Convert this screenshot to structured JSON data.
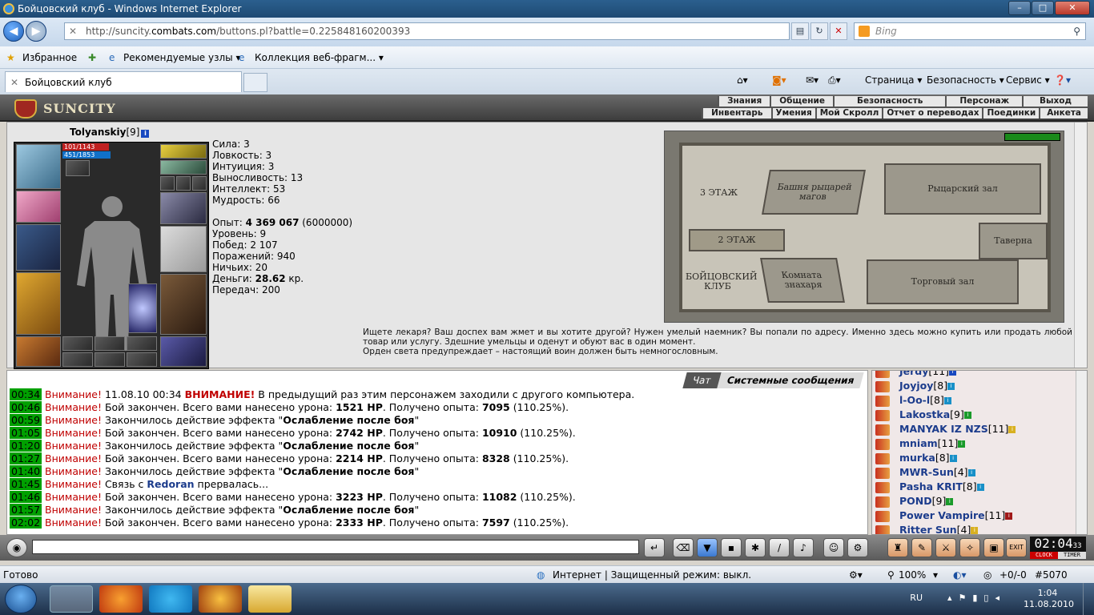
{
  "window": {
    "title": "Бойцовский клуб - Windows Internet Explorer",
    "controls": [
      "–",
      "□",
      "✕"
    ]
  },
  "address": {
    "url_prefix": "http://suncity.",
    "url_domain": "combats.com",
    "url_path": "/buttons.pl?battle=0.225848160200393",
    "search_placeholder": "Bing"
  },
  "favorites": {
    "label": "Избранное",
    "links": [
      "Рекомендуемые узлы ▾",
      "Коллекция веб-фрагм... ▾"
    ]
  },
  "tabs": {
    "active": "Бойцовский клуб",
    "commands": [
      "Страница ▾",
      "Безопасность ▾",
      "Сервис ▾"
    ]
  },
  "game_header": {
    "logo": "SUNCITY",
    "menu_top": [
      "Знания",
      "Общение",
      "Безопасность",
      "Персонаж",
      "Выход"
    ],
    "menu_bottom": [
      "Инвентарь",
      "Умения",
      "Мой Скролл",
      "Отчет о переводах",
      "Поединки",
      "Анкета"
    ]
  },
  "character": {
    "name": "Tolyanskiy",
    "level": "[9]",
    "hp": "101/1143",
    "mana": "451/1853",
    "stats": [
      {
        "label": "Сила: ",
        "value": "3"
      },
      {
        "label": "Ловкость: ",
        "value": "3"
      },
      {
        "label": "Интуиция: ",
        "value": "3"
      },
      {
        "label": "Выносливость: ",
        "value": "13"
      },
      {
        "label": "Интеллект: ",
        "value": "53"
      },
      {
        "label": "Мудрость: ",
        "value": "66"
      }
    ],
    "exp_label": "Опыт: ",
    "exp_value": "4 369 067",
    "exp_next": " (6000000)",
    "info": [
      {
        "label": "Уровень: ",
        "value": "9"
      },
      {
        "label": "Побед: ",
        "value": "2 107"
      },
      {
        "label": "Поражений: ",
        "value": "940"
      },
      {
        "label": "Ничьих: ",
        "value": "20"
      }
    ],
    "money_label": "Деньги: ",
    "money_value": "28.62",
    "money_unit": " кр.",
    "transfers_label": "Передач: ",
    "transfers_value": "200"
  },
  "map": {
    "floor3": "3 ЭТАЖ",
    "tower": "Башня рыцарей магов",
    "knight_hall": "Рыцарский зал",
    "floor2": "2 ЭТАЖ",
    "tavern": "Таверна",
    "fight_club": "БОЙЦОВСКИЙ КЛУБ",
    "healer_room": "Комната знахаря",
    "trade_hall": "Торговый зал"
  },
  "location_desc": [
    "Ищете лекаря? Ваш доспех вам жмет и вы хотите другой? Нужен умелый наемник? Вы попали по адресу. Именно здесь можно купить или продать любой товар или услугу. Здешние умельцы и оденут и обуют вас в один момент.",
    "Орден света предупреждает – настоящий воин должен быть немногословным."
  ],
  "chat": {
    "tabs": [
      "Чат",
      "Системные сообщения"
    ],
    "lines": [
      {
        "t": "00:34",
        "w": "Внимание!",
        "a": " 11.08.10 00:34 ",
        "b": "ВНИМАНИЕ!",
        "c": " В предыдущий раз этим персонажем заходили с другого компьютера."
      },
      {
        "t": "00:46",
        "w": "Внимание!",
        "a": " Бой закончен. Всего вами нанесено урона: ",
        "b": "1521 HP",
        "c": ". Получено опыта: ",
        "d": "7095",
        "e": " (110.25%)."
      },
      {
        "t": "00:59",
        "w": "Внимание!",
        "a": " Закончилось действие эффекта \"",
        "b": "Ослабление после боя",
        "c": "\""
      },
      {
        "t": "01:05",
        "w": "Внимание!",
        "a": " Бой закончен. Всего вами нанесено урона: ",
        "b": "2742 HP",
        "c": ". Получено опыта: ",
        "d": "10910",
        "e": " (110.25%)."
      },
      {
        "t": "01:20",
        "w": "Внимание!",
        "a": " Закончилось действие эффекта \"",
        "b": "Ослабление после боя",
        "c": "\""
      },
      {
        "t": "01:27",
        "w": "Внимание!",
        "a": " Бой закончен. Всего вами нанесено урона: ",
        "b": "2214 HP",
        "c": ". Получено опыта: ",
        "d": "8328",
        "e": " (110.25%)."
      },
      {
        "t": "01:40",
        "w": "Внимание!",
        "a": " Закончилось действие эффекта \"",
        "b": "Ослабление после боя",
        "c": "\""
      },
      {
        "t": "01:45",
        "w": "Внимание!",
        "a": " Связь с ",
        "b": "Redoran",
        "c": " прервалась..."
      },
      {
        "t": "01:46",
        "w": "Внимание!",
        "a": " Бой закончен. Всего вами нанесено урона: ",
        "b": "3223 HP",
        "c": ". Получено опыта: ",
        "d": "11082",
        "e": " (110.25%)."
      },
      {
        "t": "01:57",
        "w": "Внимание!",
        "a": " Закончилось действие эффекта \"",
        "b": "Ослабление после боя",
        "c": "\""
      },
      {
        "t": "02:02",
        "w": "Внимание!",
        "a": " Бой закончен. Всего вами нанесено урона: ",
        "b": "2333 HP",
        "c": ". Получено опыта: ",
        "d": "7597",
        "e": " (110.25%)."
      }
    ]
  },
  "online": [
    {
      "name": "Jerdy",
      "lvl": "[11]",
      "badge": "#1848c0"
    },
    {
      "name": "Joyjoy",
      "lvl": "[8]",
      "badge": "#1890c8"
    },
    {
      "name": "l-Oo-l",
      "lvl": "[8]",
      "badge": "#1890c8"
    },
    {
      "name": "Lakostka",
      "lvl": "[9]",
      "badge": "#1a9a2a"
    },
    {
      "name": "MANYAK IZ NZS",
      "lvl": "[11]",
      "badge": "#d8b020"
    },
    {
      "name": "mniam",
      "lvl": "[11]",
      "badge": "#1a9a2a"
    },
    {
      "name": "murka",
      "lvl": "[8]",
      "badge": "#1890c8"
    },
    {
      "name": "MWR-Sun",
      "lvl": "[4]",
      "badge": "#1890c8"
    },
    {
      "name": "Pasha KRIT",
      "lvl": "[8]",
      "badge": "#1890c8"
    },
    {
      "name": "POND",
      "lvl": "[9]",
      "badge": "#1a9a2a"
    },
    {
      "name": "Power Vampire",
      "lvl": "[11]",
      "badge": "#a01818"
    },
    {
      "name": "Ritter Sun",
      "lvl": "[4]",
      "badge": "#d8b020"
    }
  ],
  "clock": {
    "time": "02:04",
    "sec": "33",
    "l1": "CLOCK",
    "l2": "TIMER"
  },
  "status": {
    "left": "Готово",
    "zone": "Интернет | Защищенный режим: выкл.",
    "zoom": "100%",
    "extra": "+0/-0",
    "id": "#5070"
  },
  "taskbar": {
    "lang": "RU",
    "time": "1:04",
    "date": "11.08.2010"
  }
}
